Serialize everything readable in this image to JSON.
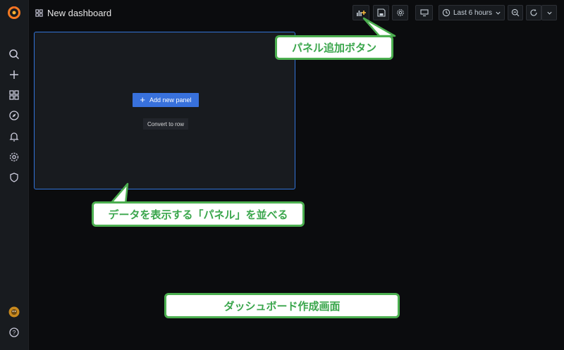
{
  "header": {
    "title": "New dashboard"
  },
  "toolbar": {
    "time_range": "Last 6 hours",
    "accent_color": "#f5b73b"
  },
  "panel": {
    "add_button": "Add new panel",
    "convert_button": "Convert to row"
  },
  "callouts": {
    "add_panel_button": "パネル追加ボタン",
    "panels_description": "データを表示する「パネル」を並べる",
    "dashboard_screen": "ダッシュボード作成画面"
  },
  "colors": {
    "callout_border": "#4caf50",
    "callout_text": "#3aa64c",
    "panel_border": "#3274d9",
    "primary_button": "#3871dc"
  }
}
